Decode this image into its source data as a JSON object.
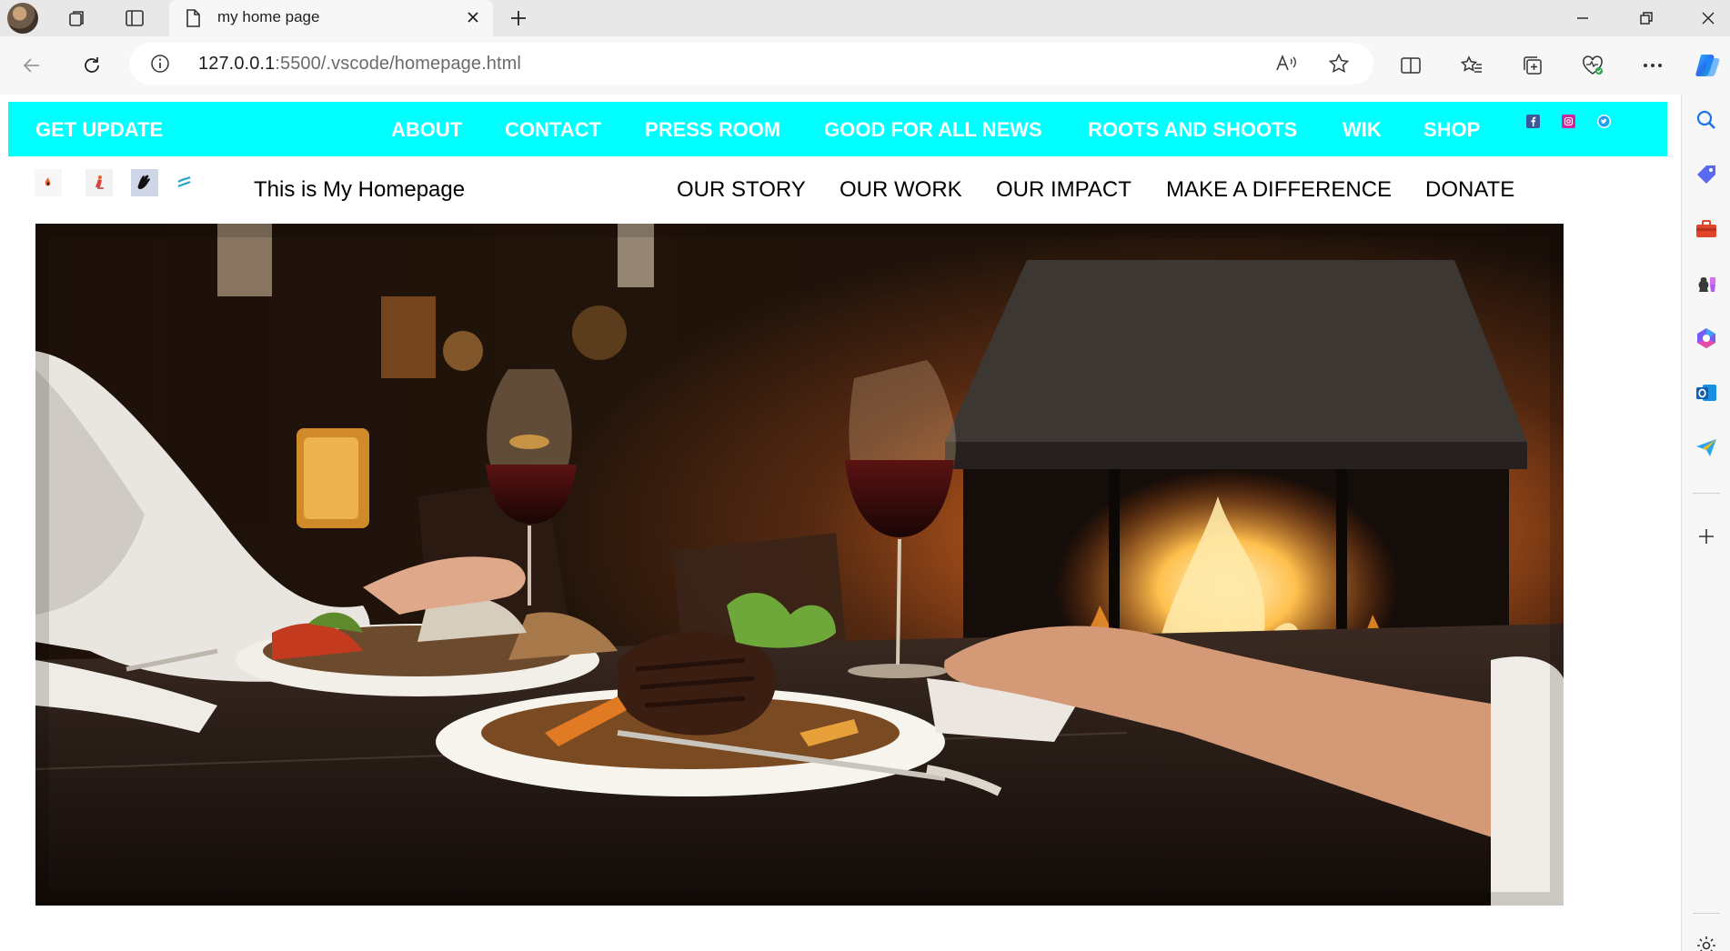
{
  "browser": {
    "tab_title": "my home page",
    "url_host": "127.0.0.1",
    "url_rest": ":5500/.vscode/homepage.html"
  },
  "page": {
    "topbar": {
      "brand": "GET UPDATE",
      "links": [
        "ABOUT",
        "CONTACT",
        "PRESS ROOM",
        "GOOD FOR ALL NEWS",
        "ROOTS AND SHOOTS",
        "WIK",
        "SHOP"
      ],
      "social": [
        "facebook-icon",
        "instagram-icon",
        "twitter-icon"
      ],
      "background": "#00ffff"
    },
    "heading": "This is My Homepage",
    "subnav": [
      "OUR STORY",
      "OUR WORK",
      "OUR IMPACT",
      "MAKE A DIFFERENCE",
      "DONATE"
    ]
  }
}
